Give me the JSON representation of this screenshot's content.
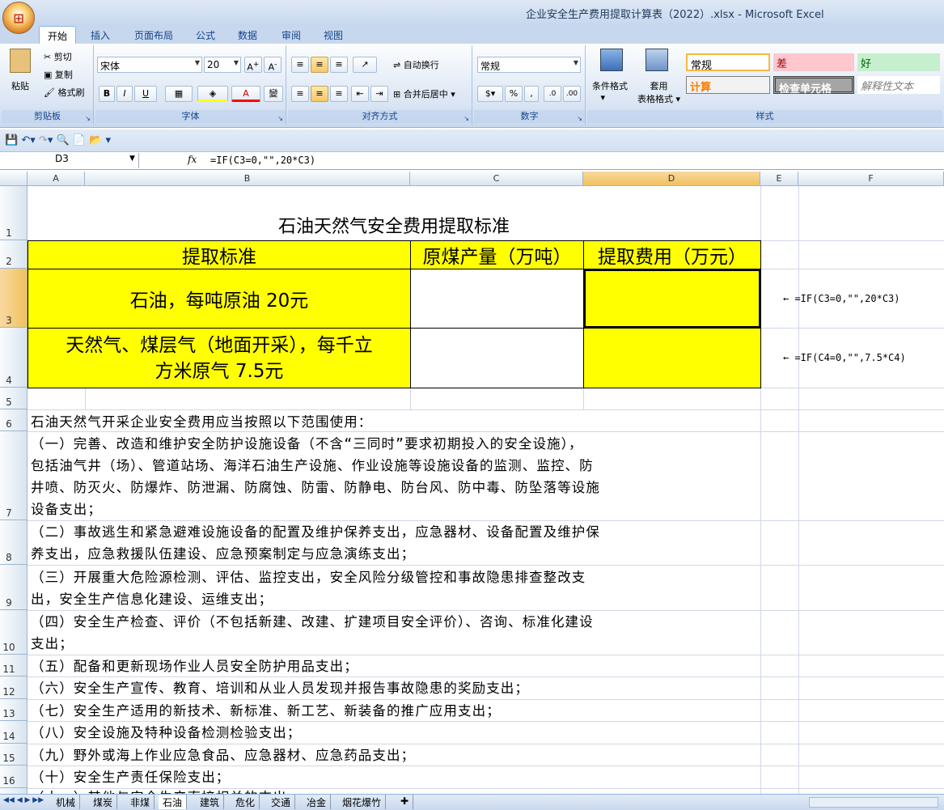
{
  "window": {
    "title": "企业安全生产费用提取计算表（2022）.xlsx - Microsoft Excel"
  },
  "ribbon_tabs": [
    "开始",
    "插入",
    "页面布局",
    "公式",
    "数据",
    "审阅",
    "视图"
  ],
  "clipboard": {
    "paste": "粘贴",
    "cut": "剪切",
    "copy": "复制",
    "format_painter": "格式刷",
    "label": "剪贴板"
  },
  "font": {
    "name": "宋体",
    "size": "20",
    "bold": "B",
    "italic": "I",
    "underline": "U",
    "label": "字体",
    "wen": "變"
  },
  "alignment": {
    "wrap": "自动换行",
    "merge": "合并后居中",
    "label": "对齐方式"
  },
  "number": {
    "format": "常规",
    "percent": "%",
    "comma": ",",
    "label": "数字"
  },
  "styles": {
    "conditional": "条件格式",
    "table": "套用",
    "table2": "表格格式",
    "label": "样式",
    "normal": "常规",
    "bad": "差",
    "good": "好",
    "calc": "计算",
    "check": "检查单元格",
    "explain": "解释性文本"
  },
  "formula_bar": {
    "namebox": "D3",
    "fx": "fx",
    "formula": "=IF(C3=0,\"\",20*C3)"
  },
  "columns": [
    "A",
    "B",
    "C",
    "D",
    "E",
    "F"
  ],
  "rows": [
    "1",
    "2",
    "3",
    "4",
    "5",
    "6",
    "7",
    "8",
    "9",
    "10",
    "11",
    "12",
    "13",
    "14",
    "15",
    "16"
  ],
  "sheet": {
    "title": "石油天然气安全费用提取标准",
    "headers": [
      "提取标准",
      "原煤产量（万吨）",
      "提取费用（万元）"
    ],
    "row3_label": "石油，每吨原油 20元",
    "row4_label_1": "天然气、煤层气（地面开采），每千立",
    "row4_label_2": "方米原气 7.5元",
    "note_row3": "← =IF(C3=0,\"\",20*C3)",
    "note_row4": "← =IF(C4=0,\"\",7.5*C4)",
    "lines": {
      "r6": "石油天然气开采企业安全费用应当按照以下范围使用：",
      "r7a": "（一）完善、改造和维护安全防护设施设备（不含“三同时”要求初期投入的安全设施），",
      "r7b": "包括油气井（场）、管道站场、海洋石油生产设施、作业设施等设施设备的监测、监控、防",
      "r7c": "井喷、防灭火、防爆炸、防泄漏、防腐蚀、防雷、防静电、防台风、防中毒、防坠落等设施",
      "r7d": "设备支出；",
      "r8a": "（二）事故逃生和紧急避难设施设备的配置及维护保养支出，应急器材、设备配置及维护保",
      "r8b": "养支出，应急救援队伍建设、应急预案制定与应急演练支出；",
      "r9a": "（三）开展重大危险源检测、评估、监控支出，安全风险分级管控和事故隐患排查整改支",
      "r9b": "出，安全生产信息化建设、运维支出；",
      "r10a": "（四）安全生产检查、评价（不包括新建、改建、扩建项目安全评价）、咨询、标准化建设",
      "r10b": "支出；",
      "r11": "（五）配备和更新现场作业人员安全防护用品支出；",
      "r12": "（六）安全生产宣传、教育、培训和从业人员发现并报告事故隐患的奖励支出；",
      "r13": "（七）安全生产适用的新技术、新标准、新工艺、新装备的推广应用支出；",
      "r14": "（八）安全设施及特种设备检测检验支出；",
      "r15": "（九）野外或海上作业应急食品、应急器材、应急药品支出；",
      "r16": "（十）安全生产责任保险支出；",
      "r17_partial": "（十一）其他与安全生产直接相关的支出。"
    }
  },
  "sheet_tabs": [
    "机械",
    "煤炭",
    "非煤",
    "石油",
    "建筑",
    "危化",
    "交通",
    "冶金",
    "烟花爆竹"
  ],
  "active_sheet": "石油"
}
